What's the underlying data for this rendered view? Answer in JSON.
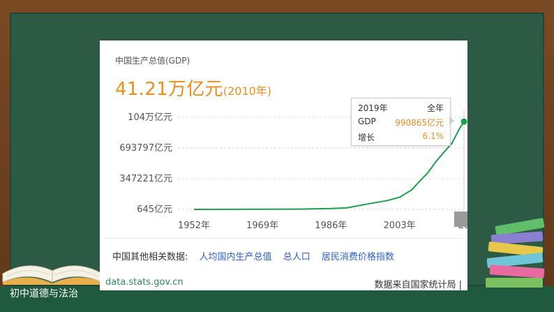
{
  "slide": {
    "course_label": "初中道德与法治"
  },
  "card": {
    "title": "中国生产总值(GDP)",
    "headline_value": "41.21万亿元",
    "headline_year": "(2010年)",
    "tooltip": {
      "year": "2019年",
      "period": "全年",
      "gdp_label": "GDP",
      "gdp_value": "990865亿元",
      "growth_label": "增长",
      "growth_value": "6.1%"
    },
    "related_label": "中国其他相关数据:",
    "related_links": [
      "人均国内生产总值",
      "总人口",
      "居民消费价格指数"
    ],
    "source_site": "data.stats.gov.cn",
    "source_note": "数据来自国家统计局",
    "footer_sep": "|"
  },
  "chart_data": {
    "type": "line",
    "series": [
      {
        "name": "GDP",
        "color": "#1aa04a"
      }
    ],
    "x": [
      1952,
      1960,
      1969,
      1978,
      1986,
      1990,
      1995,
      2000,
      2003,
      2006,
      2008,
      2010,
      2012,
      2014,
      2016,
      2018,
      2019
    ],
    "values": [
      645,
      1470,
      1945,
      3679,
      10376,
      18923,
      61340,
      100280,
      137422,
      219438,
      319516,
      412119,
      538580,
      643563,
      746395,
      919281,
      990865
    ],
    "y_ticks": [
      "645亿元",
      "347221亿元",
      "693797亿元",
      "104万亿元"
    ],
    "x_ticks": [
      "1952年",
      "1969年",
      "1986年",
      "2003年",
      "20"
    ],
    "ylim": [
      645,
      1040000
    ],
    "xlim": [
      1952,
      2019
    ],
    "grid": true
  }
}
